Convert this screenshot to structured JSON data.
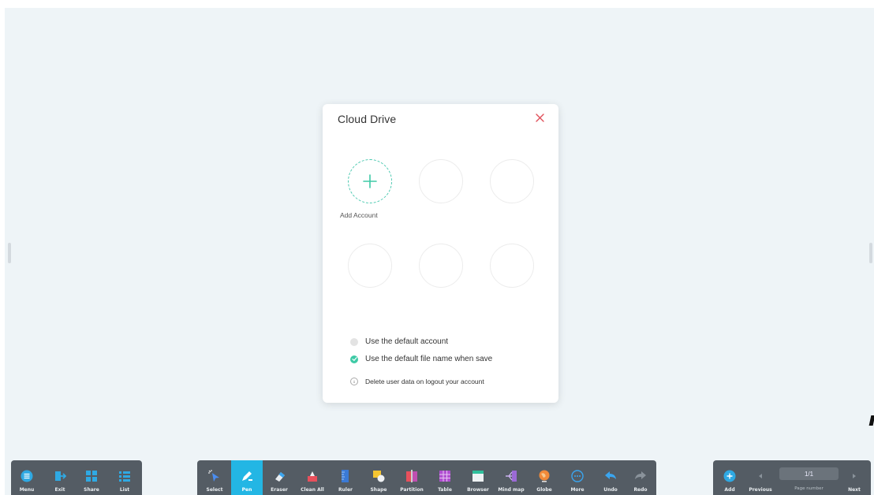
{
  "dialog": {
    "title": "Cloud Drive",
    "add_account_label": "Add Account",
    "options": [
      {
        "label": "Use the default account",
        "checked": false
      },
      {
        "label": "Use the default file name when save",
        "checked": true
      },
      {
        "label": "Delete user data on logout your account",
        "checked": false
      }
    ],
    "close_icon": "close-icon",
    "accent_color": "#3ecaa6"
  },
  "left_toolbar": {
    "items": [
      {
        "label": "Menu",
        "icon": "menu-icon"
      },
      {
        "label": "Exit",
        "icon": "exit-icon"
      },
      {
        "label": "Share",
        "icon": "share-icon"
      },
      {
        "label": "List",
        "icon": "list-icon"
      }
    ]
  },
  "main_toolbar": {
    "items": [
      {
        "label": "Select",
        "icon": "select-icon"
      },
      {
        "label": "Pen",
        "icon": "pen-icon",
        "active": true
      },
      {
        "label": "Eraser",
        "icon": "eraser-icon"
      },
      {
        "label": "Clean All",
        "icon": "clean-all-icon"
      },
      {
        "label": "Ruler",
        "icon": "ruler-icon"
      },
      {
        "label": "Shape",
        "icon": "shape-icon"
      },
      {
        "label": "Partition",
        "icon": "partition-icon"
      },
      {
        "label": "Table",
        "icon": "table-icon"
      },
      {
        "label": "Browser",
        "icon": "browser-icon"
      },
      {
        "label": "Mind map",
        "icon": "mind-map-icon"
      },
      {
        "label": "Globe",
        "icon": "globe-icon"
      },
      {
        "label": "More",
        "icon": "more-icon"
      },
      {
        "label": "Undo",
        "icon": "undo-icon"
      },
      {
        "label": "Redo",
        "icon": "redo-icon"
      }
    ]
  },
  "page_toolbar": {
    "add_label": "Add",
    "previous_label": "Previous",
    "next_label": "Next",
    "page_value": "1/1",
    "page_number_label": "Page number"
  },
  "colors": {
    "canvas_bg": "#eef4f7",
    "toolbar_bg": "#545c64",
    "active_tool": "#23b6e4",
    "close_red": "#e0505a"
  }
}
